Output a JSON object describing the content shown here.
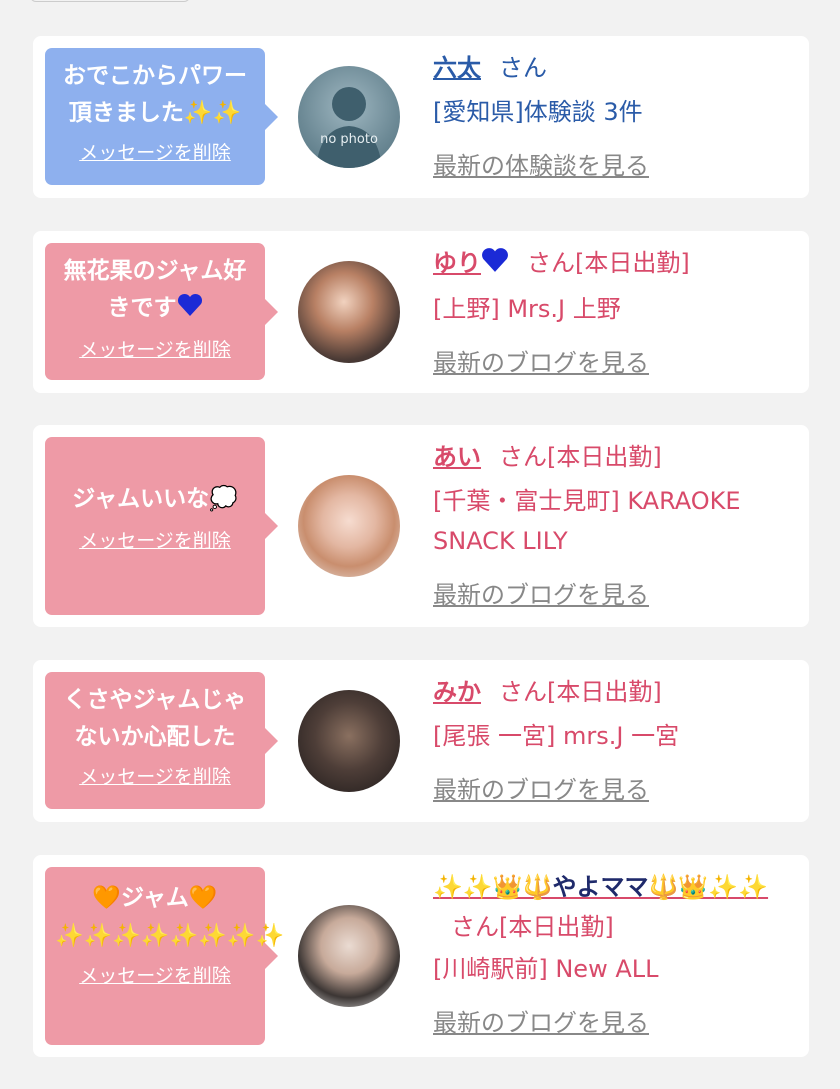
{
  "cards": [
    {
      "message": "おでこからパワー頂きました✨✨",
      "delete_label": "メッセージを削除",
      "name": "六太",
      "suffix": "さん",
      "shop_line": "[愛知県]体験談 3件",
      "link_label": "最新の体験談を見る",
      "avatar_text": "no photo"
    },
    {
      "message": "無花果のジャム好きです",
      "delete_label": "メッセージを削除",
      "name": "ゆり",
      "suffix": "さん[本日出勤]",
      "shop_line": "[上野] Mrs.J 上野",
      "link_label": "最新のブログを見る"
    },
    {
      "message": "ジャムいいな💭",
      "delete_label": "メッセージを削除",
      "name": "あい",
      "suffix": "さん[本日出勤]",
      "shop_line": "[千葉・富士見町] KARAOKE SNACK LILY",
      "link_label": "最新のブログを見る"
    },
    {
      "message": "くさやジャムじゃないか心配した",
      "delete_label": "メッセージを削除",
      "name": "みか",
      "suffix": "さん[本日出勤]",
      "shop_line": "[尾張 一宮] mrs.J 一宮",
      "link_label": "最新のブログを見る"
    },
    {
      "message": "🧡ジャム🧡 ✨✨✨✨✨✨✨✨",
      "delete_label": "メッセージを削除",
      "name": "✨✨👑🔱やよママ🔱👑✨✨",
      "suffix": "さん[本日出勤]",
      "shop_line": "[川崎駅前] New ALL",
      "link_label": "最新のブログを見る"
    }
  ],
  "colors": {
    "bubble_blue": "#8eb0ee",
    "bubble_pink": "#ee9aa6",
    "text_blue": "#2a5ba8",
    "text_pink": "#d84a6a",
    "link_gray": "#888888"
  }
}
